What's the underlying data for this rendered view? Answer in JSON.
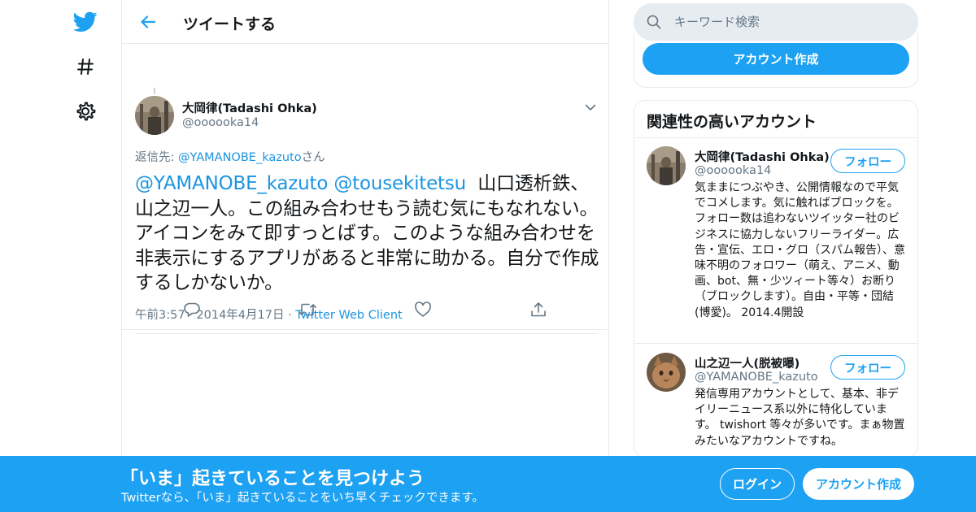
{
  "colors": {
    "accent": "#1da1f2",
    "link": "#1b95e0",
    "text": "#14171a",
    "muted": "#657786",
    "border": "#e6ecf0"
  },
  "nav": {
    "logo_icon": "twitter-bird-icon",
    "explore_icon": "hashtag-icon",
    "settings_icon": "gear-icon"
  },
  "header": {
    "back_icon": "arrow-left-icon",
    "title": "ツイートする"
  },
  "tweet": {
    "author_name": "大岡律(Tadashi Ohka)",
    "author_handle": "@oooooka14",
    "reply_prefix": "返信先: ",
    "reply_mention": "@YAMANOBE_kazuto",
    "reply_suffix": "さん",
    "mention_1": "@YAMANOBE_kazuto",
    "mention_2": "@tousekitetsu",
    "body": "山口透析鉄、山之辺一人。この組み合わせもう読む気にもなれない。アイコンをみて即すっとばす。このような組み合わせを非表示にするアプリがあると非常に助かる。自分で作成するしかないか。",
    "time": "午前3:57",
    "date": "2014年4月17日",
    "separator": "·",
    "client": "Twitter Web Client",
    "actions": [
      "reply-icon",
      "retweet-icon",
      "like-icon",
      "share-icon"
    ]
  },
  "search": {
    "placeholder": "キーワード検索"
  },
  "signup": {
    "label": "アカウント作成"
  },
  "related": {
    "title": "関連性の高いアカウント",
    "accounts": [
      {
        "name": "大岡律(Tadashi Ohka)",
        "handle": "@oooooka14",
        "follow_label": "フォロー",
        "bio": "気ままにつぶやき、公開情報なので平気でコメします。気に触ればブロックを。フォロー数は追わないツイッター社のビジネスに協力しないフリーライダー。広告・宣伝、エロ・グロ（スパム報告）、意味不明のフォロワー（萌え、アニメ、動画、bot、無・少ツィート等々）お断り（ブロックします）。自由・平等・団結(博愛)。 2014.4開設"
      },
      {
        "name": "山之辺一人(脱被曝)",
        "handle": "@YAMANOBE_kazuto",
        "follow_label": "フォロー",
        "bio": "発信専用アカウントとして、基本、非デイリーニュース系以外に特化しています。 twishort 等々が多いです。まぁ物置みたいなアカウントですね。"
      }
    ]
  },
  "banner": {
    "title": "「いま」起きていることを見つけよう",
    "subtitle": "Twitterなら、「いま」起きていることをいち早くチェックできます。",
    "login_label": "ログイン",
    "signup_label": "アカウント作成"
  }
}
